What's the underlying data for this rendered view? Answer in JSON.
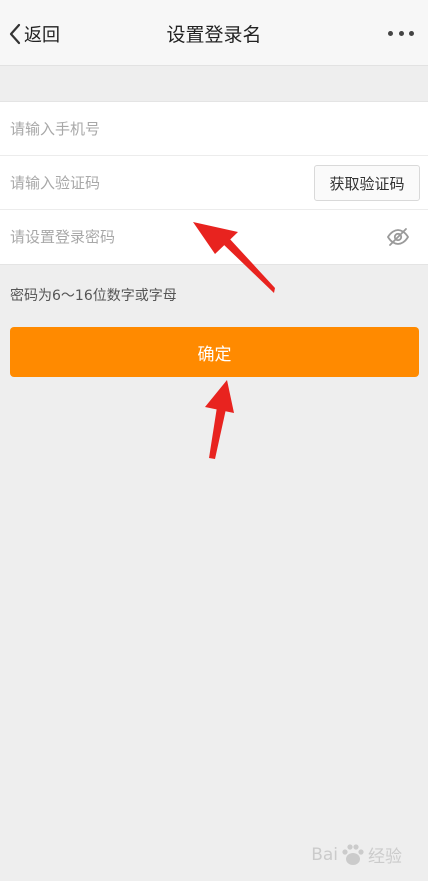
{
  "header": {
    "back_label": "返回",
    "title": "设置登录名"
  },
  "form": {
    "phone_placeholder": "请输入手机号",
    "code_placeholder": "请输入验证码",
    "get_code_label": "获取验证码",
    "password_placeholder": "请设置登录密码"
  },
  "hint": "密码为6～16位数字或字母",
  "confirm_label": "确定",
  "watermark": {
    "left_text": "Bai",
    "right_text": "经验"
  },
  "colors": {
    "accent": "#ff8a00",
    "annotation_arrow": "#e8231f"
  },
  "icons": [
    "chevron-left-icon",
    "more-dots-icon",
    "eye-off-icon"
  ]
}
